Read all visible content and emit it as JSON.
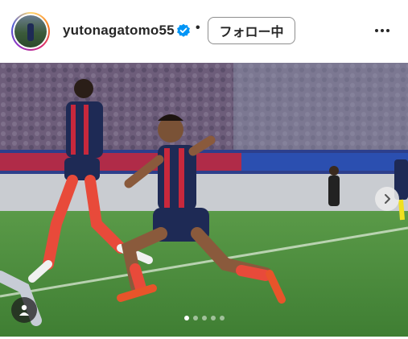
{
  "post_header": {
    "username": "yutonagatomo55",
    "verified": true,
    "separator": "•",
    "follow_button_label": "フォロー中",
    "more_icon": "more-horizontal-icon"
  },
  "media": {
    "carousel_total": 5,
    "carousel_active_index": 0,
    "next_icon": "chevron-right-icon",
    "user_tag_icon": "user-tag-icon"
  },
  "colors": {
    "text": "#262626",
    "verified_blue": "#0095f6",
    "pitch_green": "#4b8a3c",
    "kit_blue": "#1e2a55",
    "kit_red": "#c8283c",
    "boots": "#e8542a"
  }
}
